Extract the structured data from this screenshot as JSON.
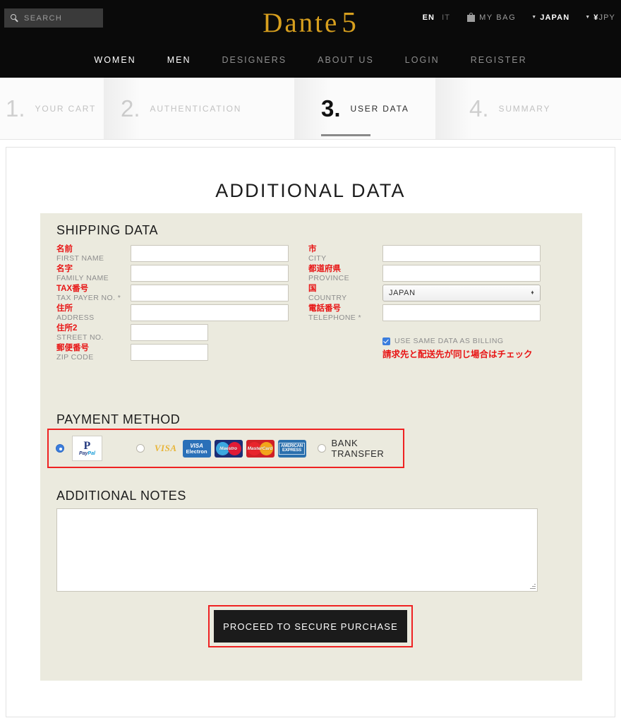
{
  "header": {
    "search": {
      "placeholder": "SEARCH",
      "icon": "search-icon"
    },
    "logo": {
      "word": "Dante",
      "number": "5"
    },
    "lang_en": "EN",
    "lang_it": "IT",
    "bag_label": "MY BAG",
    "bag_icon": "shopping-bag-icon",
    "country": "JAPAN",
    "currency_symbol": "¥",
    "currency_code": "JPY",
    "caret_icon": "chevron-down-icon",
    "nav": [
      {
        "label": "WOMEN",
        "active": true
      },
      {
        "label": "MEN",
        "active": true
      },
      {
        "label": "DESIGNERS",
        "active": false
      },
      {
        "label": "ABOUT US",
        "active": false
      },
      {
        "label": "LOGIN",
        "active": false
      },
      {
        "label": "REGISTER",
        "active": false
      }
    ]
  },
  "steps": [
    {
      "num": "1.",
      "label": "YOUR CART",
      "active": false
    },
    {
      "num": "2.",
      "label": "AUTHENTICATION",
      "active": false
    },
    {
      "num": "3.",
      "label": "USER DATA",
      "active": true
    },
    {
      "num": "4.",
      "label": "SUMMARY",
      "active": false
    }
  ],
  "page": {
    "title": "ADDITIONAL DATA",
    "shipping_title": "SHIPPING DATA",
    "payment_title": "PAYMENT METHOD",
    "notes_title": "ADDITIONAL NOTES",
    "notes_value": ""
  },
  "shipping": {
    "left": [
      {
        "jp": "名前",
        "en": "FIRST NAME",
        "value": "",
        "width": "wide"
      },
      {
        "jp": "名字",
        "en": "FAMILY NAME",
        "value": "",
        "width": "wide"
      },
      {
        "jp": "TAX番号",
        "en": "TAX PAYER NO. *",
        "value": "",
        "width": "wide"
      },
      {
        "jp": "住所",
        "en": "ADDRESS",
        "value": "",
        "width": "wide"
      },
      {
        "jp": "住所2",
        "en": "STREET NO.",
        "value": "",
        "width": "narrow"
      },
      {
        "jp": "郵便番号",
        "en": "ZIP CODE",
        "value": "",
        "width": "narrow"
      }
    ],
    "right": [
      {
        "jp": "市",
        "en": "CITY",
        "value": ""
      },
      {
        "jp": "都道府県",
        "en": "PROVINCE",
        "value": ""
      },
      {
        "jp": "国",
        "en": "COUNTRY",
        "value": "JAPAN",
        "type": "select"
      },
      {
        "jp": "電話番号",
        "en": "TELEPHONE *",
        "value": ""
      }
    ],
    "billing": {
      "checked": true,
      "label_en": "USE SAME DATA AS BILLING",
      "label_jp": "請求先と配送先が同じ場合はチェック"
    }
  },
  "payment": {
    "options": [
      {
        "id": "paypal",
        "label": "PayPal",
        "selected": true
      },
      {
        "id": "credit-card",
        "label": "VISA",
        "selected": false
      },
      {
        "id": "bank-transfer",
        "label": "BANK TRANSFER",
        "selected": false
      }
    ],
    "paypal_word_a": "Pay",
    "paypal_word_b": "Pal",
    "visa_text": "VISA",
    "cards": [
      {
        "name": "visa-electron",
        "line1": "VISA",
        "line2": "Electron"
      },
      {
        "name": "maestro",
        "line1": "Maestro",
        "line2": ""
      },
      {
        "name": "mastercard",
        "line1": "MasterCard",
        "line2": ""
      },
      {
        "name": "american-express",
        "line1": "AMERICAN",
        "line2": "EXPRESS"
      }
    ],
    "bank_transfer_label": "BANK TRANSFER"
  },
  "submit": {
    "label": "PROCEED TO SECURE PURCHASE"
  },
  "colors": {
    "header_bg": "#0a0a0a",
    "logo_gold": "#d79f1e",
    "panel_bg": "#ebeade",
    "jp_label_red": "#e81414",
    "highlight_red": "#ef2222",
    "accent_blue": "#3b7ddd",
    "button_dark": "#1b1b1b"
  }
}
